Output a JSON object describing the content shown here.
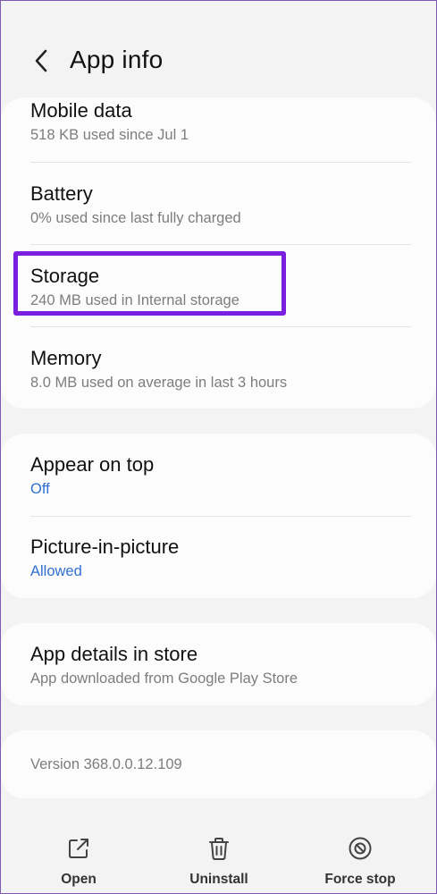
{
  "header": {
    "title": "App info",
    "back_icon": "chevron-left-icon"
  },
  "usage_card": {
    "items": [
      {
        "title": "Mobile data",
        "subtitle": "518 KB used since Jul 1"
      },
      {
        "title": "Battery",
        "subtitle": "0% used since last fully charged"
      },
      {
        "title": "Storage",
        "subtitle": "240 MB used in Internal storage"
      },
      {
        "title": "Memory",
        "subtitle": "8.0 MB used on average in last 3 hours"
      }
    ]
  },
  "permissions_card": {
    "items": [
      {
        "title": "Appear on top",
        "value": "Off"
      },
      {
        "title": "Picture-in-picture",
        "value": "Allowed"
      }
    ]
  },
  "store_card": {
    "title": "App details in store",
    "subtitle": "App downloaded from Google Play Store"
  },
  "version_card": {
    "text": "Version 368.0.0.12.109"
  },
  "actions": [
    {
      "label": "Open",
      "icon": "open-external-icon"
    },
    {
      "label": "Uninstall",
      "icon": "trash-icon"
    },
    {
      "label": "Force stop",
      "icon": "stop-circle-icon"
    }
  ],
  "colors": {
    "accent_blue": "#2f6fd1",
    "highlight": "#7a1ee0",
    "background": "#f3f3f3"
  }
}
